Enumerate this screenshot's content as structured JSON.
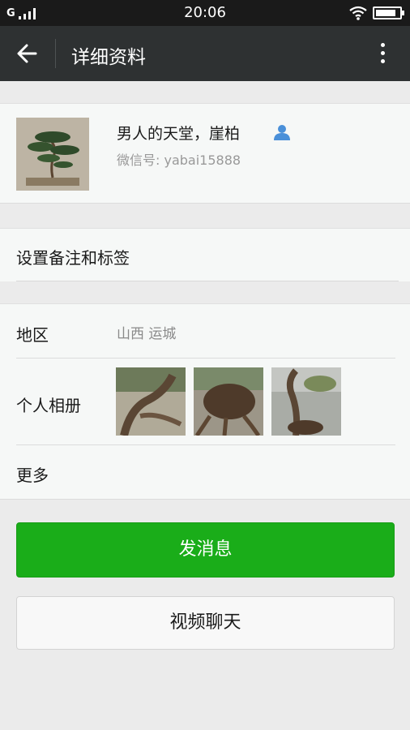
{
  "status_bar": {
    "carrier": "G",
    "time": "20:06",
    "battery_level": 0.85
  },
  "header": {
    "title": "详细资料",
    "back_icon": "arrow-left-icon",
    "more_icon": "more-vertical-icon"
  },
  "profile": {
    "name": "男人的天堂，崖柏",
    "wechat_id": "微信号: yabai15888",
    "contact_icon": "user-icon",
    "accent": "#4a90d9"
  },
  "remark": {
    "label": "设置备注和标签"
  },
  "info": {
    "region_label": "地区",
    "region_value": "山西  运城",
    "album_label": "个人相册",
    "more_label": "更多"
  },
  "actions": {
    "send_message": "发消息",
    "video_chat": "视频聊天"
  },
  "colors": {
    "primary_green": "#1aad19",
    "header_bg": "#2e3132"
  }
}
